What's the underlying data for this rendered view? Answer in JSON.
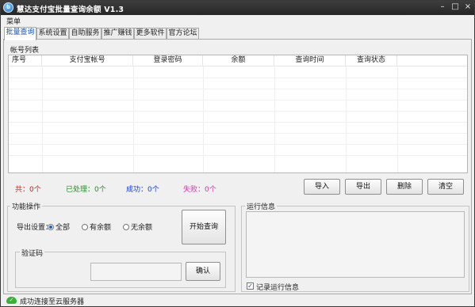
{
  "window": {
    "title": "慧达支付宝批量查询余额 V1.3",
    "icon_text": "b"
  },
  "menu": {
    "label": "菜单"
  },
  "tabs": [
    "批量查询",
    "系统设置",
    "自助服务",
    "推广赚钱",
    "更多软件",
    "官方论坛"
  ],
  "accounts": {
    "section_label": "帐号列表",
    "columns": [
      "序号",
      "支付宝帐号",
      "登录密码",
      "余额",
      "查询时间",
      "查询状态"
    ]
  },
  "stats": {
    "total": "共：0个",
    "processed": "已处理：0个",
    "success": "成功：0个",
    "failed": "失败：0个"
  },
  "actions": {
    "import": "导入",
    "export": "导出",
    "delete": "删除",
    "clear": "清空"
  },
  "function_ops": {
    "label": "功能操作",
    "export_label": "导出设置：",
    "radio_all": "全部",
    "radio_balance": "有余额",
    "radio_nobalance": "无余额",
    "start_button": "开始查询",
    "captcha_label": "验证码",
    "captcha_value": "",
    "confirm_button": "确认"
  },
  "run_info": {
    "label": "运行信息",
    "log": "",
    "record_label": "记录运行信息",
    "record_checked": true
  },
  "status": {
    "text": "成功连接至云服务器"
  },
  "colors": {
    "titlebar": "#2e2e2e",
    "active_tab_text": "#1a50a8",
    "total": "#c8281e",
    "processed": "#2a8a2a",
    "success": "#1a3fcf",
    "failed": "#d03aa8",
    "status_cloud": "#3ab03a"
  }
}
